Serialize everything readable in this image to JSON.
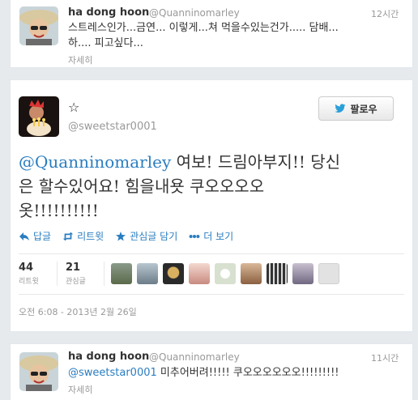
{
  "top_tweet": {
    "name": "ha dong hoon",
    "handle": "@Quanninomarley",
    "time": "12시간",
    "text_line1": "스트레스인가...금연... 이렇게...쳐 먹을수있는건가..... 담배...",
    "text_line2": "하.... 피고싶다...",
    "expand": "자세히"
  },
  "main_tweet": {
    "name": "☆",
    "handle": "@sweetstar0001",
    "follow_label": "팔로우",
    "mention": "@Quanninomarley",
    "text_line1_rest": " 여보! 드림아부지!! 당신",
    "text_line2": "은 할수있어요! 힘을내욧 쿠오오오오",
    "text_line3": "옷!!!!!!!!!!",
    "actions": {
      "reply": "답글",
      "retweet": "리트윗",
      "favorite": "관심글 담기",
      "more": "더 보기"
    },
    "stats": {
      "retweets_count": "44",
      "retweets_label": "리트윗",
      "favorites_count": "21",
      "favorites_label": "관심글"
    },
    "date": "오전 6:08 - 2013년 2월 26일"
  },
  "bottom_tweet": {
    "name": "ha dong hoon",
    "handle": "@Quanninomarley",
    "time": "11시간",
    "mention": "@sweetstar0001",
    "text_rest": " 미추어버려!!!!! 쿠오오오오오오!!!!!!!!!",
    "expand": "자세히"
  },
  "colors": {
    "link": "#2a7dc0",
    "muted": "#999999",
    "background": "#e6eaed"
  }
}
